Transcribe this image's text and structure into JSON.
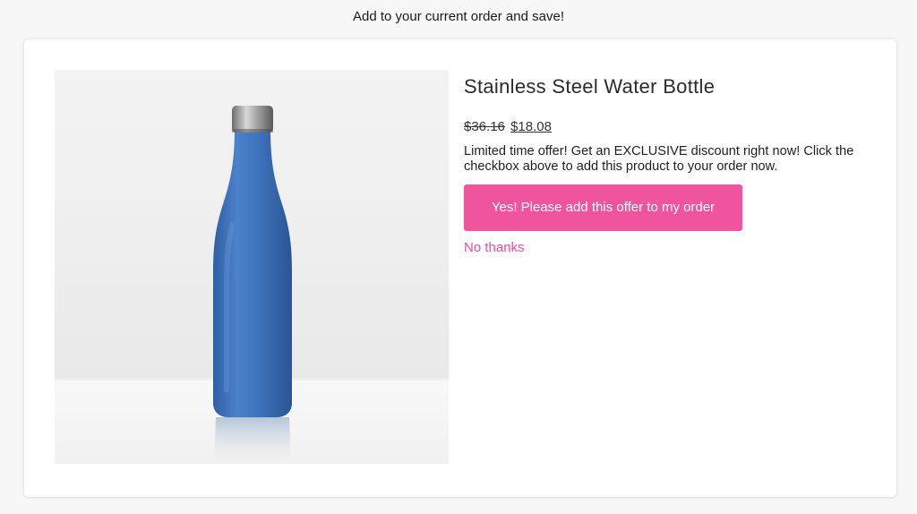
{
  "header": {
    "heading": "Add to your current order and save!"
  },
  "offer": {
    "product_title": "Stainless Steel Water Bottle",
    "original_price": "$36.16",
    "sale_price": "$18.08",
    "description": "Limited time offer! Get an EXCLUSIVE discount right now! Click the checkbox above to add this product to your order now.",
    "accept_label": "Yes! Please add this offer to my order",
    "decline_label": "No thanks"
  },
  "colors": {
    "accent": "#f0549e",
    "link": "#ee4c98",
    "bottle": "#3f74be"
  }
}
